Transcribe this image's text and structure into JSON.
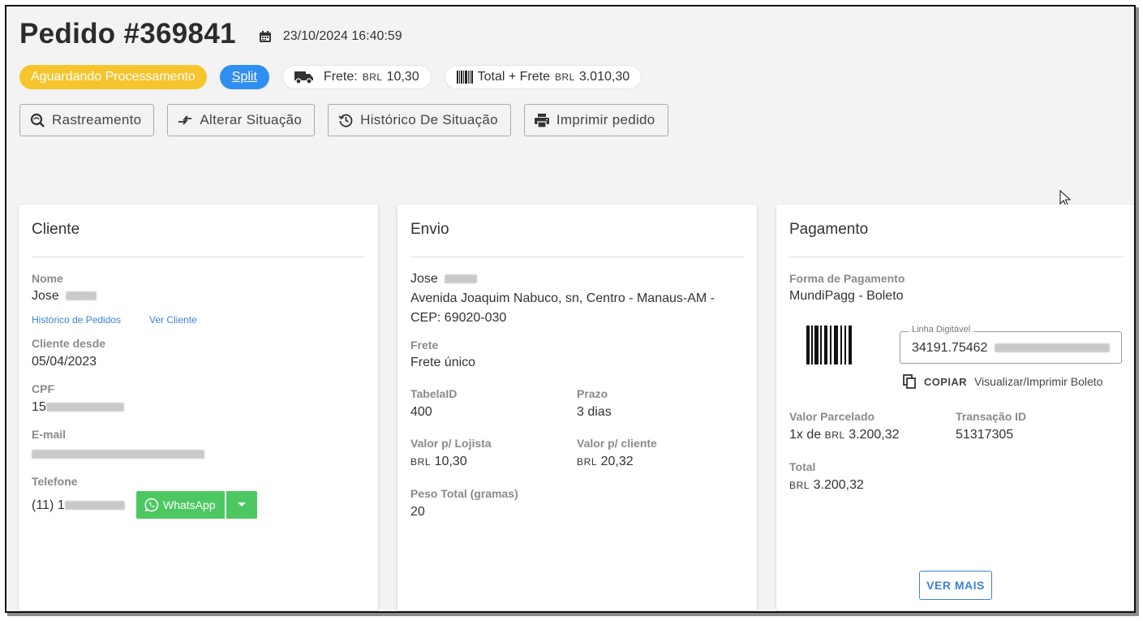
{
  "header": {
    "title": "Pedido #369841",
    "date": "23/10/2024 16:40:59"
  },
  "chips": {
    "status": "Aguardando Processamento",
    "split": "Split",
    "frete_label": "Frete:",
    "frete_currency": "BRL",
    "frete_value": "10,30",
    "total_label": "Total + Frete",
    "total_currency": "BRL",
    "total_value": "3.010,30"
  },
  "actions": {
    "rastreamento": "Rastreamento",
    "alterar": "Alterar Situação",
    "historico": "Histórico De Situação",
    "imprimir": "Imprimir pedido"
  },
  "cliente": {
    "title": "Cliente",
    "nome_label": "Nome",
    "nome_value": "Jose",
    "link_historico": "Histórico de Pedidos",
    "link_ver": "Ver Cliente",
    "desde_label": "Cliente desde",
    "desde_value": "05/04/2023",
    "cpf_label": "CPF",
    "cpf_value": "15",
    "email_label": "E-mail",
    "telefone_label": "Telefone",
    "telefone_value": "(11) 1",
    "whatsapp": "WhatsApp"
  },
  "envio": {
    "title": "Envio",
    "nome": "Jose",
    "endereco_1": "Avenida Joaquim Nabuco, sn, Centro - Manaus-AM -",
    "endereco_2": "CEP: 69020-030",
    "frete_label": "Frete",
    "frete_value": "Frete único",
    "tabela_label": "TabelaID",
    "tabela_value": "400",
    "prazo_label": "Prazo",
    "prazo_value": "3 dias",
    "lojista_label": "Valor p/ Lojista",
    "lojista_currency": "BRL",
    "lojista_value": "10,30",
    "cliente_label": "Valor p/ cliente",
    "cliente_currency": "BRL",
    "cliente_value": "20,32",
    "peso_label": "Peso Total (gramas)",
    "peso_value": "20"
  },
  "pagamento": {
    "title": "Pagamento",
    "forma_label": "Forma de Pagamento",
    "forma_value": "MundiPagg - Boleto",
    "linha_label": "Linha Digitável",
    "linha_value": "34191.75462",
    "copiar": "COPIAR",
    "visualizar": "Visualizar/Imprimir Boleto",
    "parcelado_label": "Valor Parcelado",
    "parcelado_prefix": "1x de",
    "parcelado_currency": "BRL",
    "parcelado_value": "3.200,32",
    "transacao_label": "Transação ID",
    "transacao_value": "51317305",
    "total_label": "Total",
    "total_currency": "BRL",
    "total_value": "3.200,32",
    "ver_mais": "VER MAIS"
  },
  "colors": {
    "status": "#f6c42c",
    "split": "#2f8ef2",
    "whatsapp": "#4cc762",
    "link": "#3b82d6"
  }
}
